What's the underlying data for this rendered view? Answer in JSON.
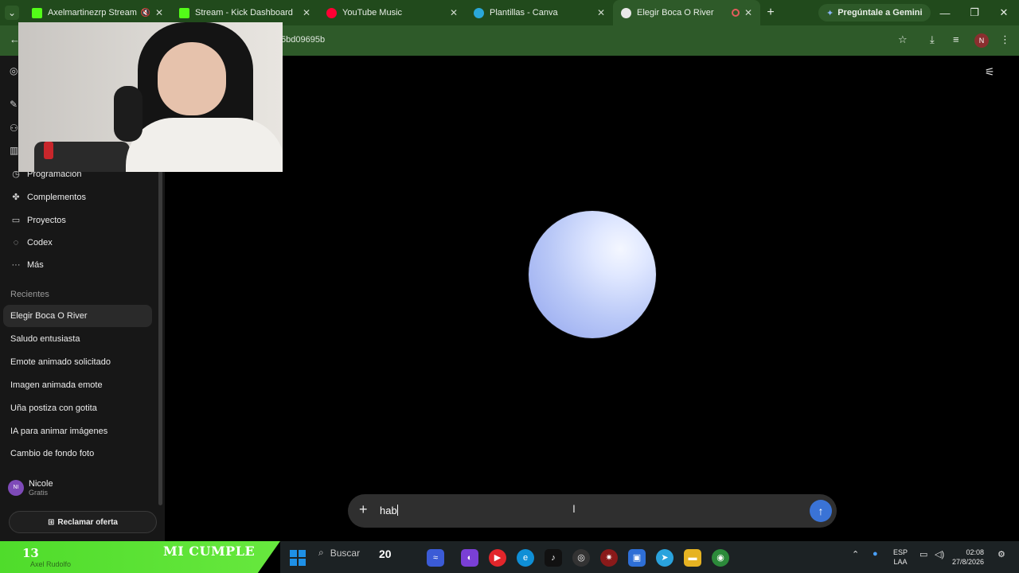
{
  "browser": {
    "tabs": [
      {
        "title": "Axelmartinezrp Stream - V",
        "favicon_color": "#53fc18",
        "muted": true
      },
      {
        "title": "Stream - Kick Dashboard",
        "favicon_color": "#53fc18"
      },
      {
        "title": "YouTube Music",
        "favicon_color": "#ff0033"
      },
      {
        "title": "Plantillas - Canva",
        "favicon_color": "#2aa7d9"
      },
      {
        "title": "Elegir Boca O River",
        "favicon_color": "#e8e8e8",
        "active": true,
        "recording": true
      }
    ],
    "new_tab": "+",
    "gemini_label": "Pregúntale a Gemini",
    "url_fragment": "5bd09695b",
    "profile_initial": "N"
  },
  "sidebar": {
    "items": [
      {
        "label": "Programación",
        "icon": "clock-icon"
      },
      {
        "label": "Complementos",
        "icon": "puzzle-icon"
      },
      {
        "label": "Proyectos",
        "icon": "folder-icon"
      },
      {
        "label": "Codex",
        "icon": "codex-icon"
      },
      {
        "label": "Más",
        "icon": "more-icon"
      }
    ],
    "recents_heading": "Recientes",
    "recents": [
      {
        "label": "Elegir Boca O River",
        "active": true
      },
      {
        "label": "Saludo entusiasta"
      },
      {
        "label": "Emote animado solicitado"
      },
      {
        "label": "Imagen animada emote"
      },
      {
        "label": "Uña postiza con gotita"
      },
      {
        "label": "IA para animar imágenes"
      },
      {
        "label": "Cambio de fondo foto"
      }
    ],
    "user": {
      "initials": "NI",
      "name": "Nicole",
      "plan": "Gratis"
    },
    "offer_label": "Reclamar oferta"
  },
  "composer": {
    "value": "hab",
    "plus": "+",
    "send_icon": "arrow-up-icon"
  },
  "stream_banner": {
    "day": "13",
    "text": "MI CUMPLE",
    "sub": "Axel Rudolfo"
  },
  "taskbar": {
    "search_placeholder": "Buscar",
    "weather_temp": "20",
    "lang_top": "ESP",
    "lang_bottom": "LAA",
    "time": "02:08",
    "date": "27/8/2026"
  },
  "colors": {
    "browser_frame": "#214a1c",
    "send_button": "#3a73d6",
    "banner_green": "#53dc2b"
  }
}
